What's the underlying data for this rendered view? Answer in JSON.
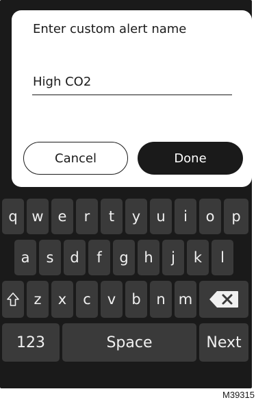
{
  "dialog": {
    "title": "Enter custom alert name",
    "field_value": "High CO2",
    "cancel_label": "Cancel",
    "done_label": "Done"
  },
  "keyboard": {
    "row1": [
      "q",
      "w",
      "e",
      "r",
      "t",
      "y",
      "u",
      "i",
      "o",
      "p"
    ],
    "row2": [
      "a",
      "s",
      "d",
      "f",
      "g",
      "h",
      "j",
      "k",
      "l"
    ],
    "row3": [
      "z",
      "x",
      "c",
      "v",
      "b",
      "n",
      "m"
    ],
    "numbers_label": "123",
    "space_label": "Space",
    "next_label": "Next",
    "shift_icon": "shift-arrow-icon",
    "backspace_icon": "backspace-icon"
  },
  "footer": {
    "code": "M39315"
  },
  "colors": {
    "keyboard_bg": "#1a1a1a",
    "key_bg": "#3a3a3a",
    "dialog_bg": "#ffffff",
    "text_dark": "#1a1a1a"
  }
}
